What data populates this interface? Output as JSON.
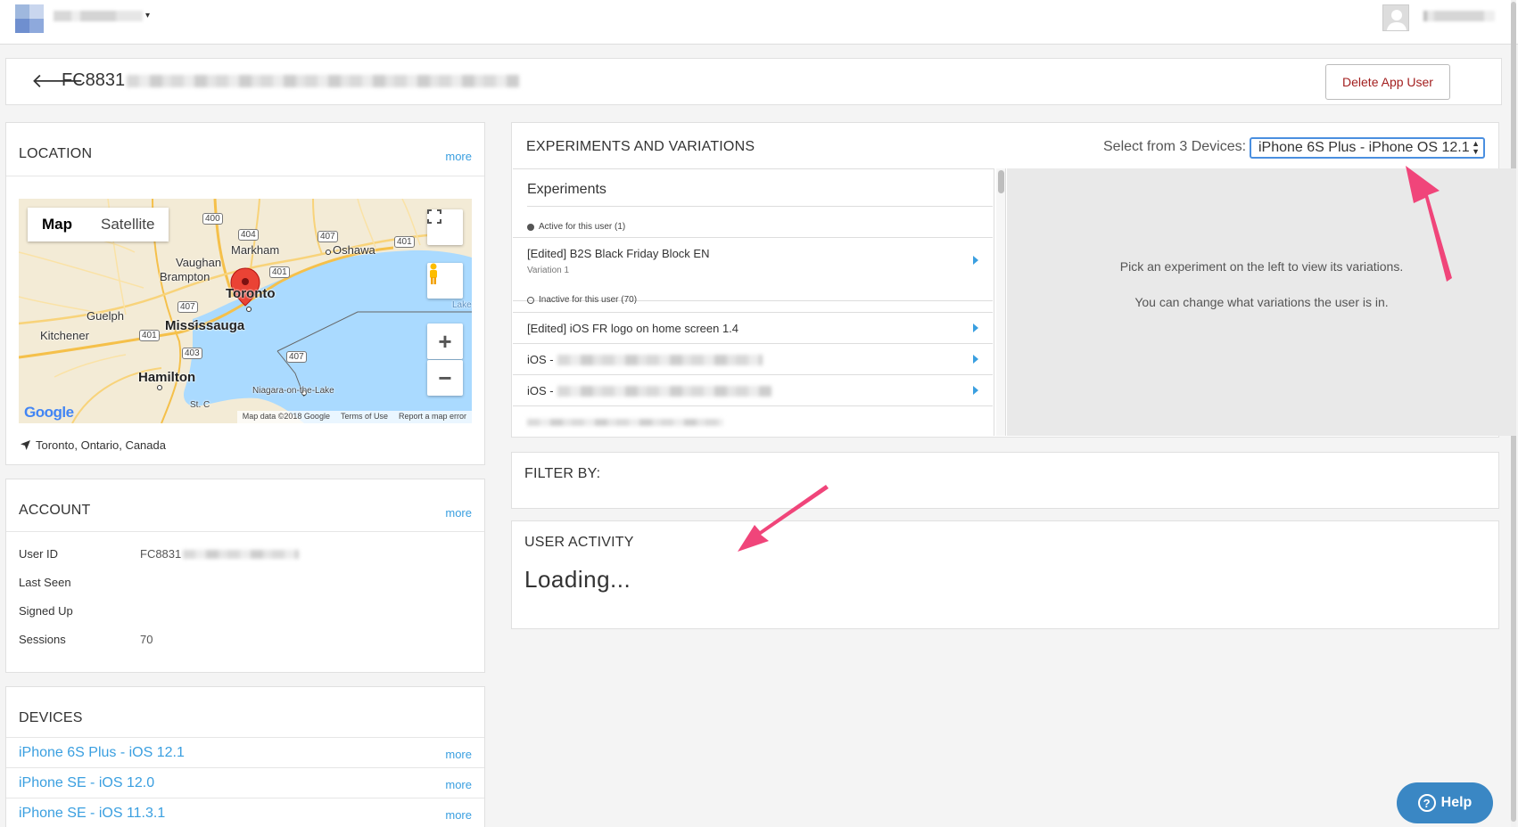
{
  "topbar": {
    "org_dropdown_caret": "▾"
  },
  "header": {
    "user_id_prefix": "FC8831",
    "delete_button": "Delete App User"
  },
  "location": {
    "title": "LOCATION",
    "more": "more",
    "map_types": [
      "Map",
      "Satellite"
    ],
    "map_labels": {
      "markham": "Markham",
      "oshawa": "Oshawa",
      "vaughan": "Vaughan",
      "brampton": "Brampton",
      "toronto": "Toronto",
      "guelph": "Guelph",
      "mississauga": "Mississauga",
      "kitchener": "Kitchener",
      "hamilton": "Hamilton",
      "niagara": "Niagara-on-the-Lake",
      "st_c": "St. C",
      "lake": "Lake"
    },
    "highway_shields": [
      "400",
      "404",
      "407",
      "401",
      "401",
      "407",
      "401",
      "403",
      "407"
    ],
    "map_footer": {
      "data": "Map data ©2018 Google",
      "terms": "Terms of Use",
      "report": "Report a map error"
    },
    "google_logo": "Google",
    "place": "Toronto, Ontario, Canada"
  },
  "account": {
    "title": "ACCOUNT",
    "more": "more",
    "rows": [
      {
        "label": "User ID",
        "value": "FC8831"
      },
      {
        "label": "Last Seen",
        "value": ""
      },
      {
        "label": "Signed Up",
        "value": ""
      },
      {
        "label": "Sessions",
        "value": "70"
      }
    ]
  },
  "devices": {
    "title": "DEVICES",
    "items": [
      {
        "name": "iPhone 6S Plus - iOS 12.1",
        "more": "more"
      },
      {
        "name": "iPhone SE - iOS 12.0",
        "more": "more"
      },
      {
        "name": "iPhone SE - iOS 11.3.1",
        "more": "more"
      }
    ]
  },
  "experiments": {
    "title": "EXPERIMENTS AND VARIATIONS",
    "select_label": "Select from 3 Devices:",
    "selected_device": "iPhone 6S Plus - iPhone OS 12.1",
    "list_heading": "Experiments",
    "active_group": "Active for this user (1)",
    "inactive_group": "Inactive for this user (70)",
    "active_items": [
      {
        "name": "[Edited] B2S Black Friday Block EN",
        "variation": "Variation 1"
      }
    ],
    "inactive_items": [
      {
        "name": "[Edited] iOS FR logo on home screen 1.4"
      },
      {
        "name": "iOS -"
      },
      {
        "name": "iOS -"
      }
    ],
    "pane_message_1": "Pick an experiment on the left to view its variations.",
    "pane_message_2": "You can change what variations the user is in."
  },
  "filter": {
    "title": "FILTER BY:"
  },
  "activity": {
    "title": "USER ACTIVITY",
    "status": "Loading..."
  },
  "help": {
    "label": "Help",
    "glyph": "?"
  },
  "colors": {
    "link": "#3a9fe0",
    "danger_text": "#a31f1f",
    "annotation_arrow": "#f0457a",
    "help_button": "#3a87c4",
    "water": "#aadaff"
  }
}
